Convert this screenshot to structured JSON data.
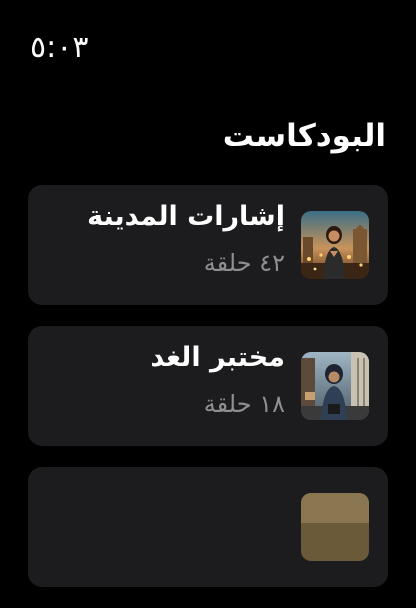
{
  "status": {
    "time": "٥:٠٣"
  },
  "header": {
    "title": "البودكاست"
  },
  "podcasts": [
    {
      "title": "إشارات المدينة",
      "episodes": "٤٢ حلقة"
    },
    {
      "title": "مختبر الغد",
      "episodes": "١٨ حلقة"
    },
    {
      "title": "",
      "episodes": ""
    }
  ],
  "colors": {
    "background": "#000000",
    "card": "#1c1c1e",
    "secondary_text": "#8e8e93"
  }
}
